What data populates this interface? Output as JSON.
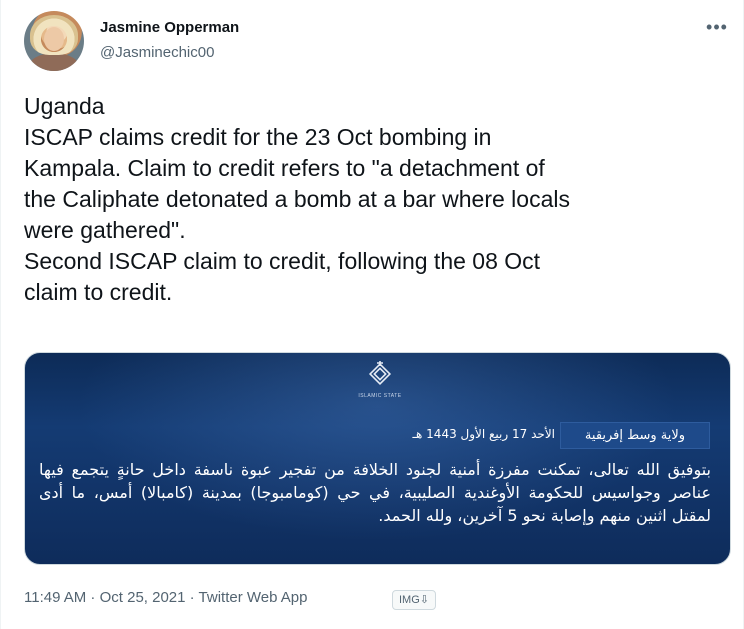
{
  "author": {
    "display_name": "Jasmine Opperman",
    "handle": "@Jasminechic00",
    "avatar_icon": "profile-photo"
  },
  "more_icon": "more-horizontal-icon",
  "tweet": {
    "lines": [
      "Uganda",
      "ISCAP claims credit for the 23 Oct bombing in",
      "Kampala. Claim to credit refers to \"a detachment of",
      "the Caliphate detonated a bomb at a bar where locals",
      "were gathered\".",
      "Second ISCAP claim to credit, following the 08 Oct",
      "claim to credit."
    ]
  },
  "media": {
    "emblem_label": "ISLAMIC STATE",
    "province": "ولاية وسط إفريقية",
    "date": "الأحد 17 ربيع الأول 1443 هـ",
    "body": "بتوفيق الله تعالى، تمكنت مفرزة أمنية لجنود الخلافة من تفجير عبوة ناسفة داخل حانةٍ يتجمع فيها عناصر وجواسيس للحكومة الأوغندية الصليبية، في حي (كومامبوجا) بمدينة (كامبالا) أمس، ما أدى لمقتل اثنين منهم وإصابة نحو 5 آخرين، ولله الحمد.",
    "colors": {
      "background": "#12356a",
      "box": "#1e4a8a"
    }
  },
  "meta": {
    "timestamp": "11:49 AM · Oct 25, 2021 · Twitter Web App",
    "badge": "IMG⇩"
  }
}
